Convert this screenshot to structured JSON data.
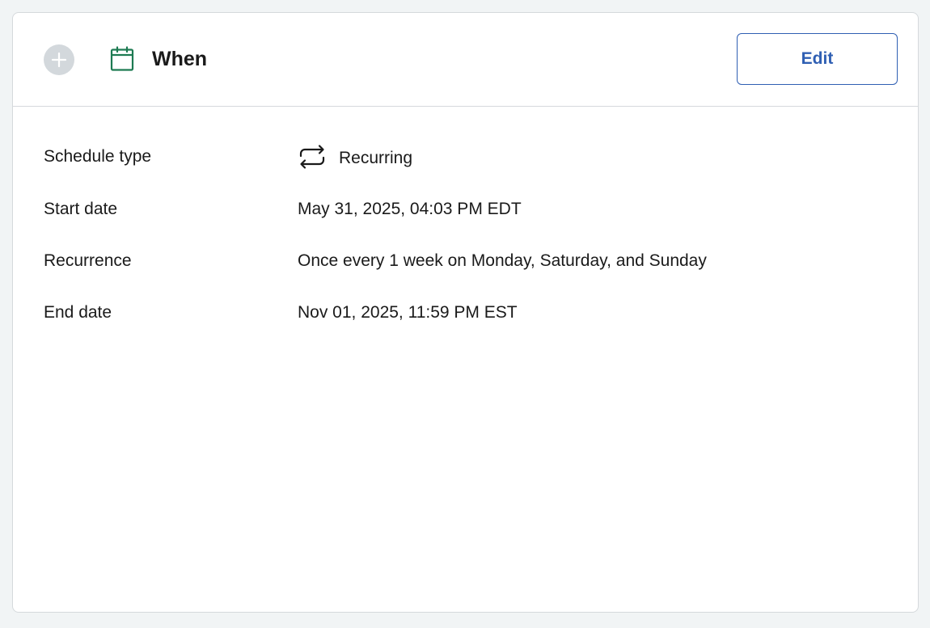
{
  "card": {
    "title": "When",
    "step_icon": "plus-icon",
    "title_icon": "calendar-icon",
    "edit_label": "Edit",
    "colors": {
      "accent": "#2f5fb3",
      "calendar_icon": "#1d7a52",
      "step_circle": "#d3d8dc"
    }
  },
  "details": {
    "schedule_type": {
      "label": "Schedule type",
      "icon": "repeat-icon",
      "value": "Recurring"
    },
    "start_date": {
      "label": "Start date",
      "value": "May 31, 2025, 04:03 PM EDT"
    },
    "recurrence": {
      "label": "Recurrence",
      "value": "Once every 1 week on Monday, Saturday, and Sunday"
    },
    "end_date": {
      "label": "End date",
      "value": "Nov 01, 2025, 11:59 PM EST"
    }
  }
}
